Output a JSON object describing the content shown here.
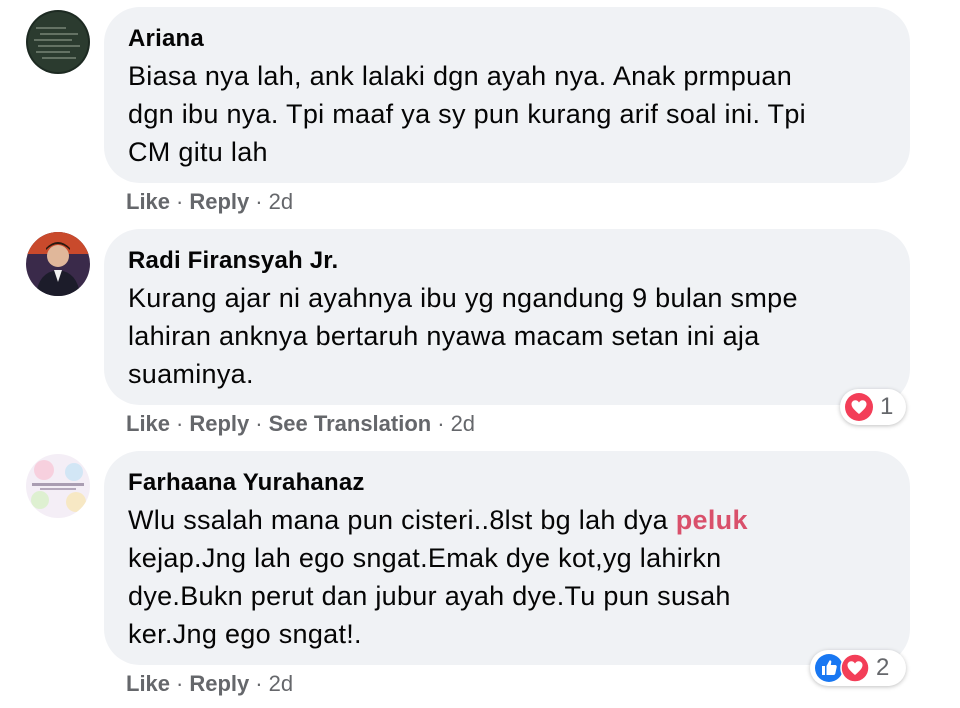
{
  "comments": [
    {
      "author": "Ariana",
      "lines": [
        "Biasa nya lah, ank lalaki dgn ayah nya. Anak prmpuan",
        "dgn ibu nya. Tpi maaf ya sy pun kurang arif soal ini. Tpi",
        "CM gitu lah"
      ],
      "like": "Like",
      "reply": "Reply",
      "time": "2d"
    },
    {
      "author": "Radi Firansyah Jr.",
      "lines": [
        "Kurang ajar ni ayahnya ibu yg ngandung 9 bulan smpe",
        "lahiran anknya bertaruh nyawa macam setan ini aja",
        "suaminya."
      ],
      "like": "Like",
      "reply": "Reply",
      "translate": "See Translation",
      "time": "2d",
      "reaction_count": "1",
      "reaction_icons": [
        "love-icon"
      ]
    },
    {
      "author": "Farhaana Yurahanaz",
      "line1_before": "Wlu ssalah mana pun cisteri..8lst bg lah dya ",
      "line1_highlight": "peluk",
      "lines_rest": [
        "kejap.Jng lah ego sngat.Emak dye kot,yg lahirkn",
        "dye.Bukn perut dan jubur ayah dye.Tu pun susah",
        "ker.Jng ego sngat!."
      ],
      "like": "Like",
      "reply": "Reply",
      "time": "2d",
      "reaction_count": "2",
      "reaction_icons": [
        "like-icon",
        "love-icon"
      ]
    }
  ],
  "separator": "·",
  "colors": {
    "bubble": "#f0f2f5",
    "meta_text": "#65676b",
    "highlight": "#d9506b",
    "love": "#f33e58",
    "like": "#1877f2"
  }
}
